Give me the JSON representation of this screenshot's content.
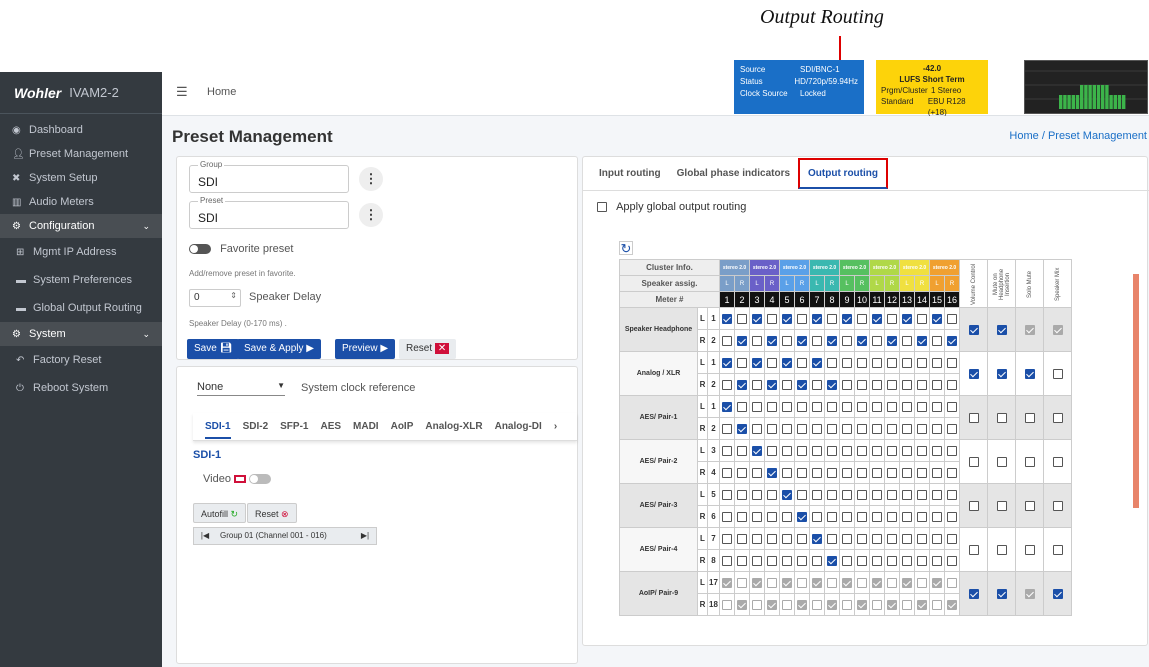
{
  "annotation": "Output Routing",
  "brand": {
    "logo": "Wohler",
    "model": "IVAM2-2"
  },
  "sidebar": {
    "items": [
      {
        "label": "Dashboard",
        "icon": "dashboard-icon"
      },
      {
        "label": "Preset Management",
        "icon": "users-icon"
      },
      {
        "label": "System Setup",
        "icon": "tools-icon"
      },
      {
        "label": "Audio Meters",
        "icon": "chart-icon"
      },
      {
        "label": "Configuration",
        "icon": "gear-icon"
      },
      {
        "label": "Mgmt IP Address",
        "icon": "network-icon"
      },
      {
        "label": "System Preferences",
        "icon": "window-icon"
      },
      {
        "label": "Global Output Routing",
        "icon": "window-icon"
      },
      {
        "label": "System",
        "icon": "gears-icon"
      },
      {
        "label": "Factory Reset",
        "icon": "undo-icon"
      },
      {
        "label": "Reboot System",
        "icon": "power-icon"
      }
    ]
  },
  "topbar": {
    "home": "Home"
  },
  "source": {
    "source_k": "Source",
    "source_v": "SDI/BNC-1",
    "status_k": "Status",
    "status_v": "HD/720p/59.94Hz",
    "clock_k": "Clock Source",
    "clock_v": "Locked"
  },
  "loudness": {
    "value": "-42.0",
    "mode": "LUFS  Short Term",
    "prgm_k": "Prgm/Cluster",
    "prgm_v": "1  Stereo",
    "std_k": "Standard",
    "std_v": "EBU R128 (+18)"
  },
  "page": {
    "title": "Preset Management",
    "crumb_home": "Home",
    "crumb_sep": "/",
    "crumb_cur": "Preset Management"
  },
  "left": {
    "group_label": "Group",
    "group_value": "SDI",
    "preset_label": "Preset",
    "preset_value": "SDI",
    "favorite": "Favorite preset",
    "fav_hint": "Add/remove preset in favorite.",
    "delay_value": "0",
    "delay_label": "Speaker Delay",
    "delay_hint": "Speaker Delay (0-170 ms) .",
    "save": "Save",
    "save_apply": "Save & Apply",
    "preview": "Preview",
    "reset": "Reset"
  },
  "left2": {
    "clock_value": "None",
    "clock_label": "System clock reference",
    "tabs": [
      "SDI-1",
      "SDI-2",
      "SFP-1",
      "AES",
      "MADI",
      "AoIP",
      "Analog-XLR",
      "Analog-DI"
    ],
    "section": "SDI-1",
    "video": "Video",
    "autofill": "Autofill",
    "reset": "Reset",
    "group_nav": "Group 01 (Channel 001 - 016)"
  },
  "right": {
    "tabs": [
      "Input routing",
      "Global phase indicators",
      "Output routing"
    ],
    "apply_global": "Apply global output routing",
    "cluster_info": "Cluster Info.",
    "speaker_assig": "Speaker assig.",
    "meter": "Meter #",
    "cluster_tag": "stereo 2.0",
    "lr": [
      "L",
      "R",
      "L",
      "R",
      "L",
      "R",
      "L",
      "R",
      "L",
      "R",
      "L",
      "R",
      "L",
      "R",
      "L",
      "R"
    ],
    "meters": [
      "1",
      "2",
      "3",
      "4",
      "5",
      "6",
      "7",
      "8",
      "9",
      "10",
      "11",
      "12",
      "13",
      "14",
      "15",
      "16"
    ],
    "cluster_colors": [
      "#7a9ec8",
      "#6a60c8",
      "#5aa0e8",
      "#3ab8b0",
      "#56c060",
      "#b0d848",
      "#f0e040",
      "#f0a030",
      "#e8605a"
    ],
    "cols": [
      "Volume Control",
      "Mute on Headphone Insertion",
      "Solo Mute",
      "Speaker Mix"
    ],
    "rows": [
      {
        "name": "Speaker Headphone",
        "chs": [
          {
            "lr": "L",
            "n": "1",
            "on": [
              1,
              0,
              1,
              0,
              1,
              0,
              1,
              0,
              1,
              0,
              1,
              0,
              1,
              0,
              1,
              0
            ]
          },
          {
            "lr": "R",
            "n": "2",
            "on": [
              0,
              1,
              0,
              1,
              0,
              1,
              0,
              1,
              0,
              1,
              0,
              1,
              0,
              1,
              0,
              1
            ]
          }
        ],
        "opts": [
          1,
          1,
          1,
          1
        ],
        "dis": [
          0,
          0,
          1,
          1
        ]
      },
      {
        "name": "Analog / XLR",
        "chs": [
          {
            "lr": "L",
            "n": "1",
            "on": [
              1,
              0,
              1,
              0,
              1,
              0,
              1,
              0,
              0,
              0,
              0,
              0,
              0,
              0,
              0,
              0
            ]
          },
          {
            "lr": "R",
            "n": "2",
            "on": [
              0,
              1,
              0,
              1,
              0,
              1,
              0,
              1,
              0,
              0,
              0,
              0,
              0,
              0,
              0,
              0
            ]
          }
        ],
        "opts": [
          1,
          1,
          1,
          0
        ],
        "dis": [
          0,
          0,
          0,
          0
        ]
      },
      {
        "name": "AES/ Pair-1",
        "chs": [
          {
            "lr": "L",
            "n": "1",
            "on": [
              1,
              0,
              0,
              0,
              0,
              0,
              0,
              0,
              0,
              0,
              0,
              0,
              0,
              0,
              0,
              0
            ]
          },
          {
            "lr": "R",
            "n": "2",
            "on": [
              0,
              1,
              0,
              0,
              0,
              0,
              0,
              0,
              0,
              0,
              0,
              0,
              0,
              0,
              0,
              0
            ]
          }
        ],
        "opts": [
          0,
          0,
          0,
          0
        ],
        "dis": [
          0,
          0,
          0,
          0
        ]
      },
      {
        "name": "AES/ Pair-2",
        "chs": [
          {
            "lr": "L",
            "n": "3",
            "on": [
              0,
              0,
              1,
              0,
              0,
              0,
              0,
              0,
              0,
              0,
              0,
              0,
              0,
              0,
              0,
              0
            ]
          },
          {
            "lr": "R",
            "n": "4",
            "on": [
              0,
              0,
              0,
              1,
              0,
              0,
              0,
              0,
              0,
              0,
              0,
              0,
              0,
              0,
              0,
              0
            ]
          }
        ],
        "opts": [
          0,
          0,
          0,
          0
        ],
        "dis": [
          0,
          0,
          0,
          0
        ]
      },
      {
        "name": "AES/ Pair-3",
        "chs": [
          {
            "lr": "L",
            "n": "5",
            "on": [
              0,
              0,
              0,
              0,
              1,
              0,
              0,
              0,
              0,
              0,
              0,
              0,
              0,
              0,
              0,
              0
            ]
          },
          {
            "lr": "R",
            "n": "6",
            "on": [
              0,
              0,
              0,
              0,
              0,
              1,
              0,
              0,
              0,
              0,
              0,
              0,
              0,
              0,
              0,
              0
            ]
          }
        ],
        "opts": [
          0,
          0,
          0,
          0
        ],
        "dis": [
          0,
          0,
          0,
          0
        ]
      },
      {
        "name": "AES/ Pair-4",
        "chs": [
          {
            "lr": "L",
            "n": "7",
            "on": [
              0,
              0,
              0,
              0,
              0,
              0,
              1,
              0,
              0,
              0,
              0,
              0,
              0,
              0,
              0,
              0
            ]
          },
          {
            "lr": "R",
            "n": "8",
            "on": [
              0,
              0,
              0,
              0,
              0,
              0,
              0,
              1,
              0,
              0,
              0,
              0,
              0,
              0,
              0,
              0
            ]
          }
        ],
        "opts": [
          0,
          0,
          0,
          0
        ],
        "dis": [
          0,
          0,
          0,
          0
        ]
      },
      {
        "name": "AoIP/ Pair-9",
        "chs": [
          {
            "lr": "L",
            "n": "17",
            "on": [
              1,
              0,
              1,
              0,
              1,
              0,
              1,
              0,
              1,
              0,
              1,
              0,
              1,
              0,
              1,
              0
            ]
          },
          {
            "lr": "R",
            "n": "18",
            "on": [
              0,
              1,
              0,
              1,
              0,
              1,
              0,
              1,
              0,
              1,
              0,
              1,
              0,
              1,
              0,
              1
            ]
          }
        ],
        "opts": [
          1,
          1,
          1,
          1
        ],
        "dis": [
          0,
          0,
          1,
          0
        ],
        "grey": true
      }
    ]
  }
}
